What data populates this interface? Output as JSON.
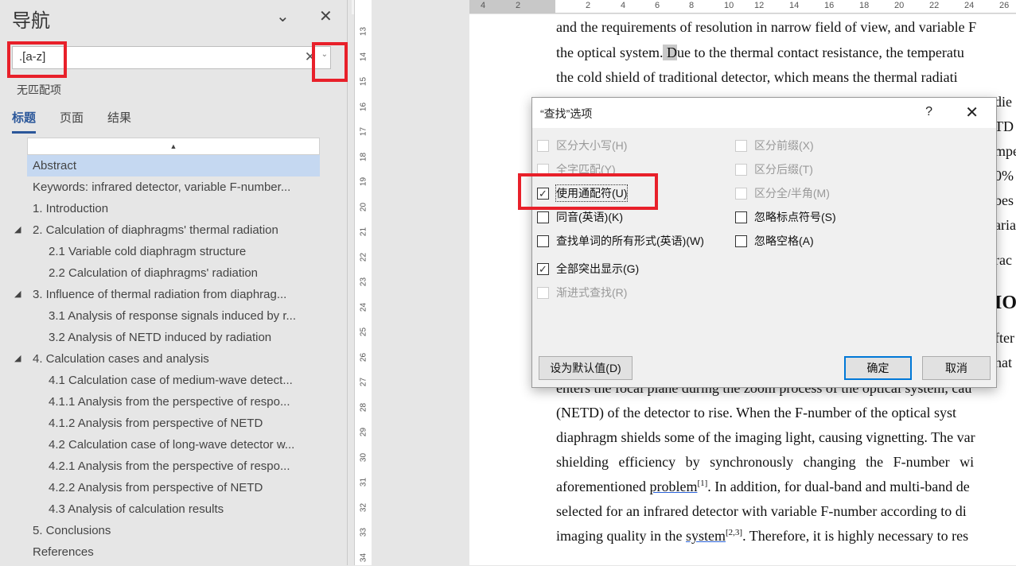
{
  "nav": {
    "title": "导航",
    "search_value": ".[a-z]",
    "no_match": "无匹配项",
    "tabs": [
      "标题",
      "页面",
      "结果"
    ],
    "headings": [
      {
        "label": "Abstract",
        "level": 1,
        "selected": true
      },
      {
        "label": "Keywords: infrared detector, variable F-number...",
        "level": 1
      },
      {
        "label": "1. Introduction",
        "level": 1
      },
      {
        "label": "2. Calculation of diaphragms' thermal radiation",
        "level": 1,
        "expanded": true
      },
      {
        "label": "2.1 Variable cold diaphragm structure",
        "level": 2
      },
      {
        "label": "2.2 Calculation of diaphragms' radiation",
        "level": 2
      },
      {
        "label": "3. Influence of thermal radiation from diaphrag...",
        "level": 1,
        "expanded": true
      },
      {
        "label": "3.1 Analysis of response signals induced by r...",
        "level": 2
      },
      {
        "label": "3.2 Analysis of NETD induced by radiation",
        "level": 2
      },
      {
        "label": "4. Calculation cases and analysis",
        "level": 1,
        "expanded": true
      },
      {
        "label": "4.1 Calculation case of medium-wave detect...",
        "level": 2
      },
      {
        "label": "4.1.1 Analysis from the perspective of respo...",
        "level": 2
      },
      {
        "label": "4.1.2 Analysis from perspective of NETD",
        "level": 2
      },
      {
        "label": "4.2 Calculation case of long-wave detector w...",
        "level": 2
      },
      {
        "label": "4.2.1 Analysis from the perspective of respo...",
        "level": 2
      },
      {
        "label": "4.2.2 Analysis from perspective of NETD",
        "level": 2
      },
      {
        "label": "4.3 Analysis of calculation results",
        "level": 2
      },
      {
        "label": "5. Conclusions",
        "level": 1
      },
      {
        "label": "References",
        "level": 1
      }
    ]
  },
  "vruler": [
    "13",
    "14",
    "15",
    "16",
    "17",
    "18",
    "19",
    "20",
    "21",
    "22",
    "23",
    "24",
    "25",
    "26",
    "27",
    "28",
    "29",
    "30",
    "31",
    "32",
    "33",
    "34"
  ],
  "hruler": [
    "4",
    "2",
    "2",
    "4",
    "6",
    "8",
    "10",
    "12",
    "14",
    "16",
    "18",
    "20",
    "22",
    "24",
    "26"
  ],
  "doc": {
    "lines": [
      "and the requirements of resolution in narrow field of view, and variable F",
      "the optical system. Due to the thermal contact resistance, the temperatu",
      "the cold shield of traditional detector, which means the thermal radiati"
    ],
    "fragments": [
      "die",
      "TD",
      "mpe",
      "0%",
      "bes",
      "aria",
      "rac",
      "IO",
      "fter",
      "hat"
    ],
    "lines2": [
      "enters the focal plane during the zoom process of the optical system, cau",
      "(NETD) of the detector to rise. When the F-number of the optical syst",
      "diaphragm shields some of the imaging light, causing vignetting. The var",
      "shielding efficiency by synchronously changing the F-number wi"
    ],
    "line_ref1": {
      "pre": "aforementioned ",
      "link": "problem",
      "sup": "[1]",
      "post": ". In addition, for dual-band and multi-band de"
    },
    "line_sel": "selected for an infrared detector with variable F-number according to di",
    "line_ref2": {
      "pre": "imaging quality in the ",
      "link": "system",
      "sup": "[2,3]",
      "post": ". Therefore, it is highly necessary to res"
    }
  },
  "dialog": {
    "title": "“查找”选项",
    "help": "?",
    "close": "✕",
    "left_options": [
      {
        "label": "区分大小写(H)",
        "checked": false,
        "disabled": true
      },
      {
        "label": "全字匹配(Y)",
        "checked": false,
        "disabled": true
      },
      {
        "label": "使用通配符(U)",
        "checked": true,
        "disabled": false
      },
      {
        "label": "同音(英语)(K)",
        "checked": false,
        "disabled": false
      },
      {
        "label": "查找单词的所有形式(英语)(W)",
        "checked": false,
        "disabled": false
      },
      {
        "label": "全部突出显示(G)",
        "checked": true,
        "disabled": false
      },
      {
        "label": "渐进式查找(R)",
        "checked": false,
        "disabled": true
      }
    ],
    "right_options": [
      {
        "label": "区分前缀(X)",
        "checked": false,
        "disabled": true
      },
      {
        "label": "区分后缀(T)",
        "checked": false,
        "disabled": true
      },
      {
        "label": "区分全/半角(M)",
        "checked": false,
        "disabled": true
      },
      {
        "label": "忽略标点符号(S)",
        "checked": false,
        "disabled": false
      },
      {
        "label": "忽略空格(A)",
        "checked": false,
        "disabled": false
      }
    ],
    "default_btn": "设为默认值(D)",
    "ok_btn": "确定",
    "cancel_btn": "取消"
  },
  "colors": {
    "accent": "#2b579a",
    "highlight_box": "#e8202a",
    "selected_heading": "#c5d8f1"
  }
}
